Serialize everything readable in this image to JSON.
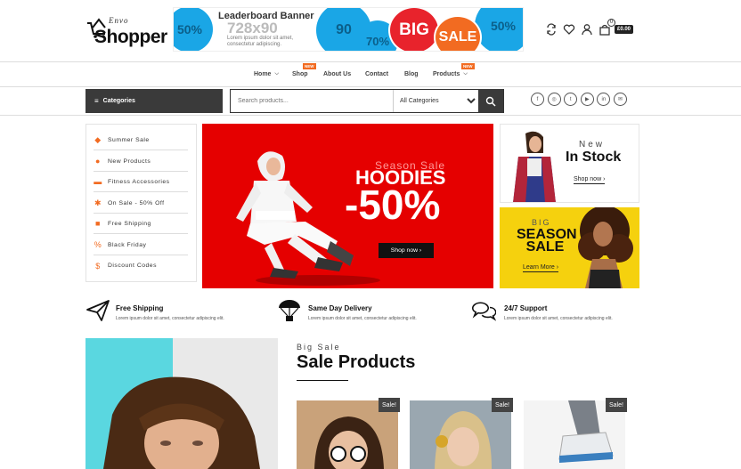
{
  "header": {
    "logo_small": "Envo",
    "logo_big": "Shopper",
    "cart_count": "0",
    "cart_total": "£0.00"
  },
  "banner": {
    "title": "Leaderboard Banner",
    "size": "728x90",
    "lorem": "Lorem ipsum dolor sit amet, consectetur adipiscing.",
    "big": "BIG",
    "sale": "SALE",
    "p1": "50%",
    "p2": "90",
    "p3": "70%",
    "p4": "50%"
  },
  "nav": {
    "items": [
      {
        "label": "Home"
      },
      {
        "label": "Shop",
        "tag": "NEW"
      },
      {
        "label": "About Us"
      },
      {
        "label": "Contact"
      },
      {
        "label": "Blog"
      },
      {
        "label": "Products",
        "tag": "NEW"
      }
    ]
  },
  "search": {
    "categories_label": "Categories",
    "placeholder": "Search products...",
    "select_value": "All Categories"
  },
  "sidebar": {
    "items": [
      {
        "label": "Summer Sale",
        "icon": "tag-icon"
      },
      {
        "label": "New Products",
        "icon": "users-icon"
      },
      {
        "label": "Fitness Accessories",
        "icon": "dumbbell-icon"
      },
      {
        "label": "On Sale - 50% Off",
        "icon": "discount-icon"
      },
      {
        "label": "Free Shipping",
        "icon": "truck-icon"
      },
      {
        "label": "Black Friday",
        "icon": "percent-icon"
      },
      {
        "label": "Discount Codes",
        "icon": "dollar-icon"
      }
    ]
  },
  "hero": {
    "kicker": "Season Sale",
    "title": "HOODIES",
    "pct": "-50%",
    "button": "Shop now"
  },
  "promo1": {
    "kicker": "New",
    "title": "In Stock",
    "link": "Shop now"
  },
  "promo2": {
    "kicker": "BIG",
    "title": "SEASON SALE",
    "link": "Learn More"
  },
  "features": [
    {
      "title": "Free Shipping",
      "desc": "Lorem ipsum dolor sit amet, consectetur adipiscing elit."
    },
    {
      "title": "Same Day Delivery",
      "desc": "Lorem ipsum dolor sit amet, consectetur adipiscing elit."
    },
    {
      "title": "24/7 Support",
      "desc": "Lorem ipsum dolor sit amet, consectetur adipiscing elit."
    }
  ],
  "sale_section": {
    "kicker": "Big Sale",
    "title": "Sale Products",
    "badge": "Sale!"
  },
  "colors": {
    "accent": "#f26b21",
    "hero_bg": "#e50000",
    "promo_yellow": "#f5d10e",
    "dark": "#3a3a3a"
  }
}
